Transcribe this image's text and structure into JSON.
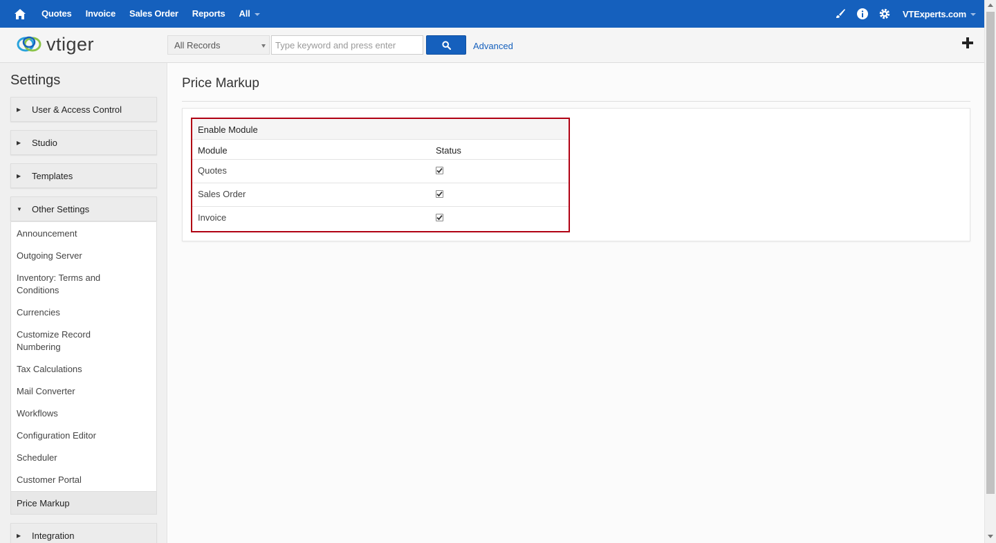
{
  "topbar": {
    "nav": [
      "Quotes",
      "Invoice",
      "Sales Order",
      "Reports",
      "All"
    ],
    "user": "VTExperts.com",
    "icons": [
      "home-icon",
      "brush-icon",
      "info-icon",
      "gear-icon"
    ],
    "color": "#1560bd"
  },
  "subbar": {
    "logo": "vtiger",
    "search_select": "All Records",
    "search_placeholder": "Type keyword and press enter",
    "advanced": "Advanced"
  },
  "sidebar": {
    "title": "Settings",
    "groups": [
      "User & Access Control",
      "Studio",
      "Templates",
      "Other Settings",
      "Integration"
    ],
    "items": [
      "Announcement",
      "Outgoing Server",
      "Inventory: Terms and Conditions",
      "Currencies",
      "Customize Record Numbering",
      "Tax Calculations",
      "Mail Converter",
      "Workflows",
      "Configuration Editor",
      "Scheduler",
      "Customer Portal"
    ],
    "active": "Price Markup"
  },
  "main": {
    "title": "Price Markup",
    "table": {
      "caption": "Enable Module",
      "col_module": "Module",
      "col_status": "Status",
      "rows": [
        {
          "module": "Quotes",
          "checked": true
        },
        {
          "module": "Sales Order",
          "checked": true
        },
        {
          "module": "Invoice",
          "checked": true
        }
      ]
    },
    "highlight_color": "#b00012"
  }
}
